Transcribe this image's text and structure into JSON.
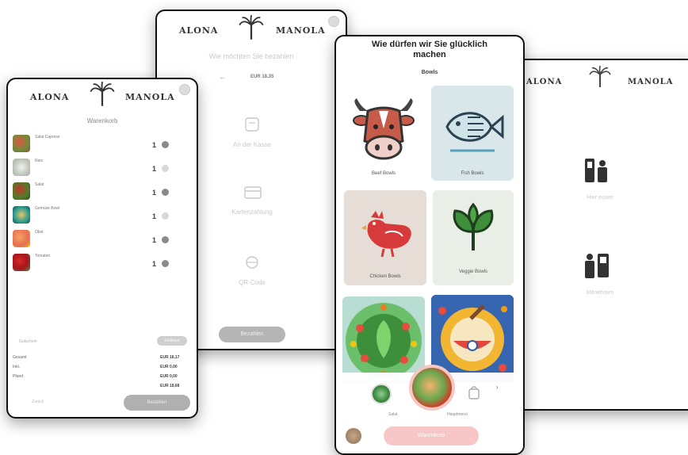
{
  "brand": {
    "left": "ALONA",
    "right": "MANOLA"
  },
  "screen_cart": {
    "title": "Warenkorb",
    "items": [
      {
        "name": "Salat Caprese",
        "qty": "1"
      },
      {
        "name": "Reis",
        "qty": "1"
      },
      {
        "name": "Salat",
        "qty": "1"
      },
      {
        "name": "Gemüse Bowl",
        "qty": "1"
      },
      {
        "name": "Obst",
        "qty": "1"
      },
      {
        "name": "Tomaten",
        "qty": "1"
      }
    ],
    "coupon_placeholder": "Gutschein",
    "coupon_button": "Einlösen",
    "totals": [
      {
        "label": "Gesamt",
        "value": "EUR 18,17"
      },
      {
        "label": "Inkl.",
        "value": "EUR 0,00"
      },
      {
        "label": "Pfand",
        "value": "EUR 0,00"
      }
    ],
    "total_value": "EUR 18,68",
    "back_button": "Zurück",
    "checkout_button": "Bestellen"
  },
  "screen_payment": {
    "title": "Wie möchten Sie bezahlen",
    "amount": "EUR 18,35",
    "options": [
      {
        "label": "An der Kasse",
        "icon": "register-icon"
      },
      {
        "label": "Kartenzahlung",
        "icon": "card-icon"
      },
      {
        "label": "QR-Code",
        "icon": "qr-icon"
      }
    ],
    "button": "Bezahlen"
  },
  "screen_menu": {
    "title_line1": "Wie dürfen wir Sie glücklich",
    "title_line2": "machen",
    "subtitle": "Bowls",
    "categories": [
      {
        "label": "Beef Bowls",
        "icon": "cow-icon"
      },
      {
        "label": "Fish Bowls",
        "icon": "fish-icon"
      },
      {
        "label": "Chicken Bowls",
        "icon": "chicken-icon"
      },
      {
        "label": "Veggie Bowls",
        "icon": "vegetable-icon"
      },
      {
        "label": "",
        "icon": "salad-art-icon"
      },
      {
        "label": "",
        "icon": "bowl-art-icon"
      }
    ],
    "footer_left": "Salat",
    "footer_right": "Hauptmenü",
    "footer_button": "Warenkorb"
  },
  "screen_kiosk": {
    "options": [
      {
        "label": "Hier essen",
        "icon": "kiosk-dine-in-icon"
      },
      {
        "label": "Mitnehmen",
        "icon": "kiosk-takeaway-icon"
      }
    ]
  },
  "colors": {
    "pill_grey": "#b5b5b5",
    "accent_pink": "#f7c6c6",
    "dark_grey": "#8a8a8a"
  }
}
